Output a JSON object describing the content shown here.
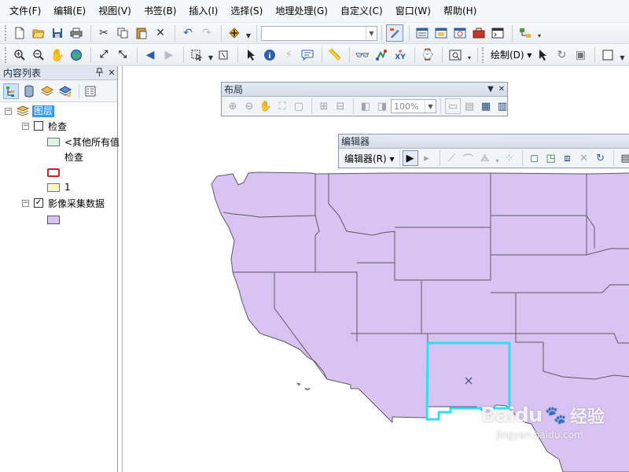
{
  "menu": [
    "文件(F)",
    "编辑(E)",
    "视图(V)",
    "书签(B)",
    "插入(I)",
    "选择(S)",
    "地理处理(G)",
    "自定义(C)",
    "窗口(W)",
    "帮助(H)"
  ],
  "toolbar2": {
    "draw_label": "绘制(D)",
    "font_name": "宋体"
  },
  "toc": {
    "title": "内容列表",
    "pin_icon": "pin-icon",
    "close_icon": "close-icon",
    "layers_root": "图层",
    "layer_check": {
      "name": "检查",
      "checked": false,
      "legend": [
        {
          "label": "<其他所有值",
          "sub": "检查",
          "color": "#dff5e3"
        },
        {
          "label": "",
          "color": "#ffffff",
          "outline": "#cc2222"
        },
        {
          "label": "1",
          "color": "#fff6c8"
        }
      ]
    },
    "layer_image": {
      "name": "影像采集数据",
      "checked": true,
      "color": "#d8c3f2"
    }
  },
  "layout_toolbar": {
    "title": "布局",
    "zoom": "100%"
  },
  "editor_toolbar": {
    "title": "编辑器",
    "menu_label": "编辑器(R)"
  },
  "map": {
    "fill_color": "#d8c3f2",
    "stroke_color": "#5a5a66",
    "selected_outline": "#33ddee"
  },
  "watermark": {
    "brand": "Baidu",
    "brand_cn": "经验",
    "url": "jingyan.baidu.com"
  }
}
